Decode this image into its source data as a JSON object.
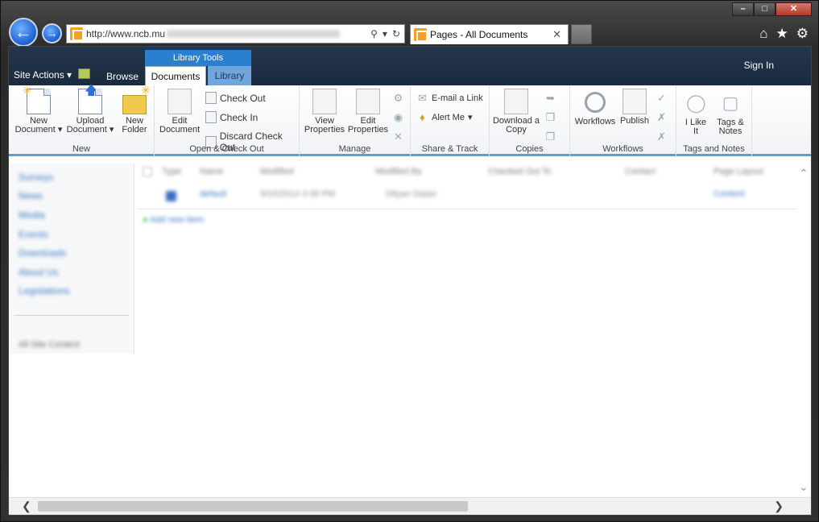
{
  "browser": {
    "url_visible": "http://www.ncb.mu",
    "tab_title": "Pages - All Documents",
    "window_buttons": [
      "minimize",
      "maximize",
      "close"
    ],
    "address_icons": [
      "search-icon",
      "dropdown-icon",
      "refresh-icon"
    ],
    "toolbar_icons": [
      "home-icon",
      "star-icon",
      "gear-icon"
    ]
  },
  "sp_header": {
    "site_actions": "Site Actions",
    "browse": "Browse",
    "library_tools": "Library Tools",
    "tab_documents": "Documents",
    "tab_library": "Library",
    "sign_in": "Sign In"
  },
  "ribbon": {
    "groups": {
      "new": "New",
      "open_checkout": "Open & Check Out",
      "manage": "Manage",
      "share_track": "Share & Track",
      "copies": "Copies",
      "workflows": "Workflows",
      "tags_notes": "Tags and Notes"
    },
    "new_document": [
      "New",
      "Document"
    ],
    "upload_document": [
      "Upload",
      "Document"
    ],
    "new_folder": [
      "New",
      "Folder"
    ],
    "edit_document": [
      "Edit",
      "Document"
    ],
    "check_out": "Check Out",
    "check_in": "Check In",
    "discard_check_out": "Discard Check Out",
    "view_properties": [
      "View",
      "Properties"
    ],
    "edit_properties": [
      "Edit",
      "Properties"
    ],
    "email_link": "E-mail a Link",
    "alert_me": "Alert Me",
    "download_copy": [
      "Download a",
      "Copy"
    ],
    "workflows": "Workflows",
    "publish": "Publish",
    "i_like_it": [
      "I Like",
      "It"
    ],
    "tags_notes": [
      "Tags &",
      "Notes"
    ]
  },
  "quick_launch": {
    "items": [
      "Surveys",
      "News",
      "Media",
      "Events",
      "Downloads",
      "About Us",
      "Legislations"
    ],
    "all_site_content": "All Site Content"
  },
  "list": {
    "columns": [
      "Type",
      "Name",
      "Modified",
      "Modified By",
      "Checked Out To",
      "Contact",
      "Page Layout"
    ],
    "rows": [
      {
        "name": "default",
        "modified": "9/15/2014 3:38 PM",
        "modified_by": "Dilyan Gaiao",
        "page_layout": "Content"
      }
    ],
    "add_new_item": "Add new item"
  }
}
